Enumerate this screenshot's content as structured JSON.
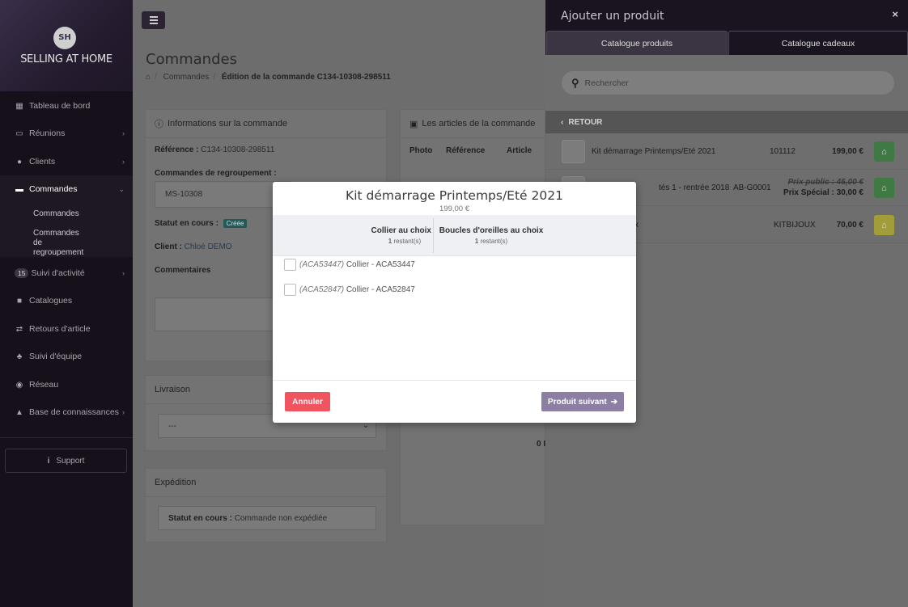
{
  "brand": {
    "logo_initials": "SH",
    "logo_text": "SELLING AT HOME"
  },
  "sidebar": {
    "items": [
      {
        "label": "Tableau de bord",
        "icon": "dashboard-icon"
      },
      {
        "label": "Réunions",
        "icon": "calendar-icon"
      },
      {
        "label": "Clients",
        "icon": "users-icon"
      },
      {
        "label": "Commandes",
        "icon": "credit-card-icon"
      },
      {
        "label": "Suivi d'activité",
        "icon": "activity-icon",
        "badge": "15"
      },
      {
        "label": "Catalogues",
        "icon": "catalog-icon"
      },
      {
        "label": "Retours d'article",
        "icon": "exchange-icon"
      },
      {
        "label": "Suivi d'équipe",
        "icon": "sitemap-icon"
      },
      {
        "label": "Réseau",
        "icon": "globe-icon"
      },
      {
        "label": "Base de connaissances",
        "icon": "graduation-cap-icon"
      }
    ],
    "subitems": [
      "Commandes",
      "Commandes de regroupement"
    ],
    "support": "Support"
  },
  "main": {
    "title": "Commandes",
    "breadcrumb": [
      "Commandes",
      "Édition de la commande C134-10308-298511"
    ],
    "info_panel": {
      "title": "Informations sur la commande",
      "ref_label": "Référence :",
      "ref_value": "C134-10308-298511",
      "group_label": "Commandes de regroupement :",
      "group_value": "MS-10308",
      "status_label": "Statut en cours :",
      "status_value": "Créée",
      "client_label": "Client :",
      "client_value": "Chloé DEMO",
      "comments_label": "Commentaires"
    },
    "articles_panel": {
      "title": "Les articles de la commande",
      "columns": [
        "Photo",
        "Référence",
        "Article"
      ],
      "partial_value": "0 I"
    },
    "delivery_panel": {
      "title": "Livraison",
      "select_value": "---"
    },
    "shipping_panel": {
      "title": "Expédition",
      "status_label": "Statut en cours :",
      "status_value": "Commande non expédiée"
    }
  },
  "drawer": {
    "title": "Ajouter un produit",
    "close": "×",
    "tabs": [
      "Catalogue produits",
      "Catalogue cadeaux"
    ],
    "search_placeholder": "Rechercher",
    "back": "RETOUR",
    "products": [
      {
        "name": "Kit démarrage Printemps/Eté 2021",
        "ref": "101112",
        "price": "199,00 €",
        "cart_color": "#4caf50"
      },
      {
        "name": "tés 1 - rentrée 2018",
        "ref": "AB-G0001",
        "old_price": "Prix public : 45,00 €",
        "price": "Prix Spécial : 30,00 €",
        "cart_color": "#4caf50"
      },
      {
        "name": "x",
        "ref": "KITBIJOUX",
        "price": "70,00 €",
        "cart_color": "#d4c94a"
      }
    ]
  },
  "modal": {
    "title": "Kit démarrage Printemps/Eté 2021",
    "price": "199,00 €",
    "columns": [
      {
        "title": "Collier au choix",
        "remaining_count": "1",
        "remaining_label": "restant(s)"
      },
      {
        "title": "Boucles d'oreilles au choix",
        "remaining_count": "1",
        "remaining_label": "restant(s)"
      }
    ],
    "options": [
      {
        "code": "(ACA53447)",
        "label": "Collier - ACA53447"
      },
      {
        "code": "(ACA52847)",
        "label": "Collier - ACA52847"
      }
    ],
    "cancel": "Annuler",
    "next": "Produit suivant"
  },
  "colors": {
    "cancel": "#f0545f",
    "next": "#8d7ea3",
    "sidebar_bg": "#151019",
    "badge_created": "#2b9e94"
  }
}
